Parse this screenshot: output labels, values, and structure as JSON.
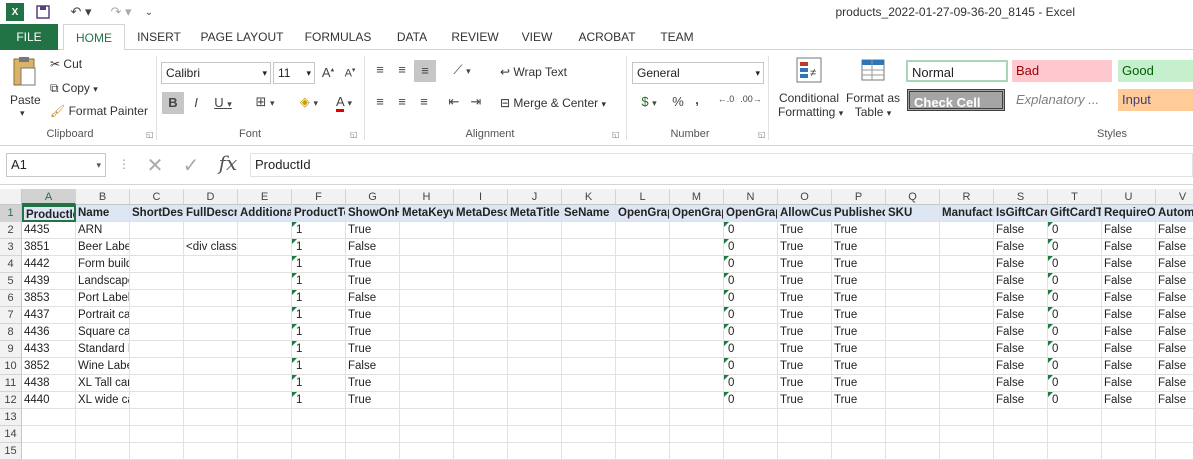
{
  "window": {
    "title": "products_2022-01-27-09-36-20_8145 - Excel"
  },
  "tabs": [
    "FILE",
    "HOME",
    "INSERT",
    "PAGE LAYOUT",
    "FORMULAS",
    "DATA",
    "REVIEW",
    "VIEW",
    "ACROBAT",
    "TEAM"
  ],
  "clipboard": {
    "paste": "Paste",
    "cut": "Cut",
    "copy": "Copy",
    "format_painter": "Format Painter",
    "label": "Clipboard"
  },
  "font": {
    "name": "Calibri",
    "size": "11",
    "label": "Font",
    "bold": "B",
    "italic": "I",
    "underline": "U"
  },
  "alignment": {
    "wrap": "Wrap Text",
    "merge": "Merge & Center",
    "label": "Alignment"
  },
  "number": {
    "format": "General",
    "label": "Number",
    "percent": "%",
    "comma": ","
  },
  "styles": {
    "conditional": "Conditional",
    "conditional2": "Formatting",
    "format_as": "Format as",
    "format_as2": "Table",
    "normal": "Normal",
    "bad": "Bad",
    "good": "Good",
    "check": "Check Cell",
    "explanatory": "Explanatory ...",
    "input": "Input",
    "label": "Styles"
  },
  "formula_bar": {
    "name_box": "A1",
    "fx": "fx",
    "value": "ProductId"
  },
  "grid": {
    "columns": [
      "A",
      "B",
      "C",
      "D",
      "E",
      "F",
      "G",
      "H",
      "I",
      "J",
      "K",
      "L",
      "M",
      "N",
      "O",
      "P",
      "Q",
      "R",
      "S",
      "T",
      "U",
      "V"
    ],
    "rows": [
      "1",
      "2",
      "3",
      "4",
      "5",
      "6",
      "7",
      "8",
      "9",
      "10",
      "11",
      "12",
      "13",
      "14",
      "15"
    ],
    "header": [
      "ProductId",
      "Name",
      "ShortDesc",
      "FullDescri",
      "Additional",
      "ProductTe",
      "ShowOnH",
      "MetaKeyw",
      "MetaDesc",
      "MetaTitle",
      "SeName",
      "OpenGrap",
      "OpenGrap",
      "OpenGrap",
      "AllowCust",
      "Published",
      "SKU",
      "Manufactu",
      "IsGiftCard",
      "GiftCardTy",
      "RequireOt",
      "Autom"
    ],
    "data": [
      [
        "4435",
        "ARN",
        "",
        "",
        "",
        "1",
        "True",
        "",
        "",
        "",
        "",
        "",
        "",
        "0",
        "True",
        "True",
        "",
        "",
        "False",
        "0",
        "False",
        "False"
      ],
      [
        "3851",
        "Beer Label",
        "",
        "<div class=\"section",
        "",
        "1",
        "False",
        "",
        "",
        "",
        "",
        "",
        "",
        "0",
        "True",
        "True",
        "",
        "",
        "False",
        "0",
        "False",
        "False"
      ],
      [
        "4442",
        "Form builder",
        "",
        "",
        "",
        "1",
        "True",
        "",
        "",
        "",
        "",
        "",
        "",
        "0",
        "True",
        "True",
        "",
        "",
        "False",
        "0",
        "False",
        "False"
      ],
      [
        "4439",
        "Landscape canvas",
        "",
        "",
        "",
        "1",
        "True",
        "",
        "",
        "",
        "",
        "",
        "",
        "0",
        "True",
        "True",
        "",
        "",
        "False",
        "0",
        "False",
        "False"
      ],
      [
        "3853",
        "Port Label",
        "",
        "",
        "",
        "1",
        "False",
        "",
        "",
        "",
        "",
        "",
        "",
        "0",
        "True",
        "True",
        "",
        "",
        "False",
        "0",
        "False",
        "False"
      ],
      [
        "4437",
        "Portrait canvas",
        "",
        "",
        "",
        "1",
        "True",
        "",
        "",
        "",
        "",
        "",
        "",
        "0",
        "True",
        "True",
        "",
        "",
        "False",
        "0",
        "False",
        "False"
      ],
      [
        "4436",
        "Square canvas",
        "",
        "",
        "",
        "1",
        "True",
        "",
        "",
        "",
        "",
        "",
        "",
        "0",
        "True",
        "True",
        "",
        "",
        "False",
        "0",
        "False",
        "False"
      ],
      [
        "4433",
        "Standard Megaedit",
        "",
        "",
        "",
        "1",
        "True",
        "",
        "",
        "",
        "",
        "",
        "",
        "0",
        "True",
        "True",
        "",
        "",
        "False",
        "0",
        "False",
        "False"
      ],
      [
        "3852",
        "Wine Label",
        "",
        "",
        "",
        "1",
        "False",
        "",
        "",
        "",
        "",
        "",
        "",
        "0",
        "True",
        "True",
        "",
        "",
        "False",
        "0",
        "False",
        "False"
      ],
      [
        "4438",
        "XL Tall canvas",
        "",
        "",
        "",
        "1",
        "True",
        "",
        "",
        "",
        "",
        "",
        "",
        "0",
        "True",
        "True",
        "",
        "",
        "False",
        "0",
        "False",
        "False"
      ],
      [
        "4440",
        "XL wide canvas",
        "",
        "",
        "",
        "1",
        "True",
        "",
        "",
        "",
        "",
        "",
        "",
        "0",
        "True",
        "True",
        "",
        "",
        "False",
        "0",
        "False",
        "False"
      ]
    ]
  },
  "colors": {
    "accent": "#217346",
    "header_fill": "#dde6f2"
  }
}
